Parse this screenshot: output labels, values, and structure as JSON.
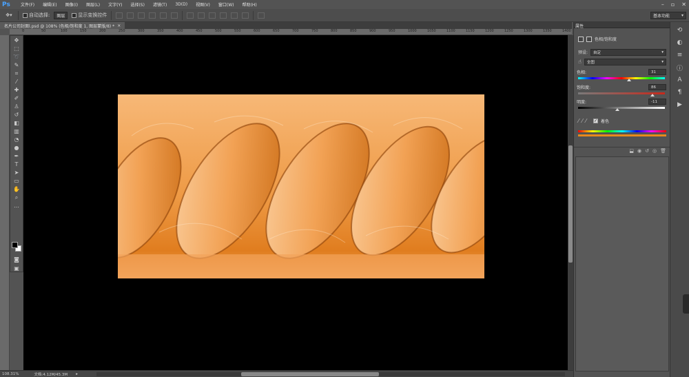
{
  "app": {
    "logo": "Ps",
    "menu": [
      "文件(F)",
      "编辑(E)",
      "图像(I)",
      "图层(L)",
      "文字(Y)",
      "选择(S)",
      "滤镜(T)",
      "3D(D)",
      "视图(V)",
      "窗口(W)",
      "帮助(H)"
    ]
  },
  "options": {
    "auto_select_label": "自动选择:",
    "auto_select_value": "图层",
    "show_transform_label": "显示变换控件",
    "workspace": "基本功能"
  },
  "document": {
    "tab_title": "名片公司封面l.psd @ 108% (色相/饱和度 1, 图层蒙版/8) *",
    "ruler_marks": [
      "0",
      "50",
      "100",
      "150",
      "200",
      "250",
      "300",
      "350",
      "400",
      "450",
      "500",
      "550",
      "600",
      "650",
      "700",
      "750",
      "800",
      "850",
      "900",
      "950",
      "1000",
      "1050",
      "1100",
      "1150",
      "1200",
      "1250",
      "1300",
      "1350",
      "1400"
    ]
  },
  "status": {
    "zoom": "108.31%",
    "doc_size": "文档:4.12M/45.3M"
  },
  "properties": {
    "tab": "属性",
    "title": "色相/饱和度",
    "preset_label": "预设:",
    "preset_value": "自定",
    "channel_value": "全图",
    "hue_label": "色相:",
    "hue_value": "31",
    "saturation_label": "饱和度:",
    "saturation_value": "86",
    "lightness_label": "明度:",
    "lightness_value": "-11",
    "colorize_label": "着色",
    "colors": {
      "accent": "#e8891c",
      "canvas": "#000000",
      "artwork_light": "#f6b26b",
      "artwork_mid": "#e8891c",
      "artwork_dark": "#9a4a08"
    }
  }
}
